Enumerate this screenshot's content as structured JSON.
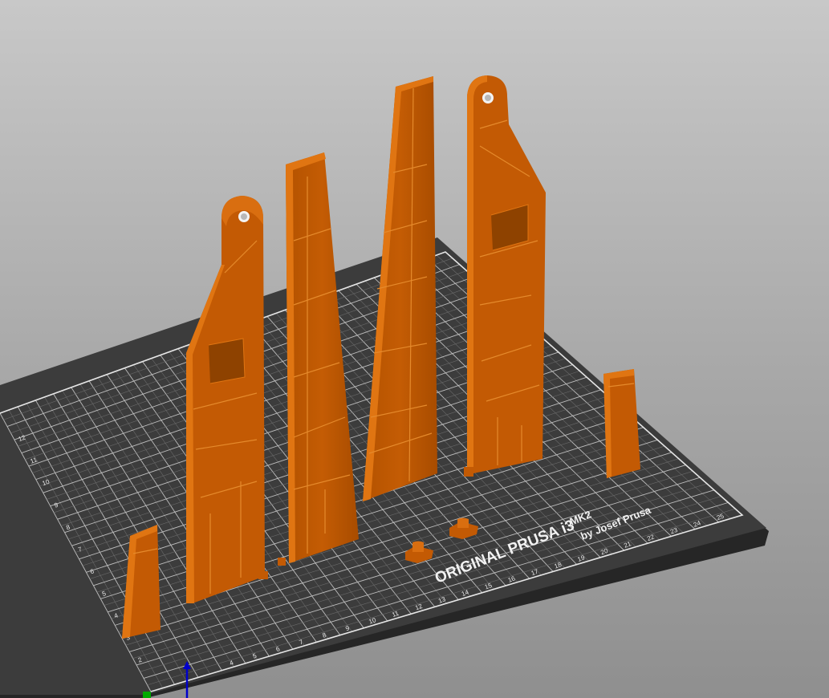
{
  "viewport": {
    "name": "3D print preview",
    "colors": {
      "background_top": "#c8c8c8",
      "background_bottom": "#8f8f8f",
      "bed": "#3a3a3a",
      "bed_edge": "#262626",
      "grid": "#d9d9d9",
      "part": "#c85a00",
      "part_light": "#e07512",
      "part_dark": "#8a3c00",
      "axis_z": "#0000cc",
      "axis_x": "#00aa00"
    }
  },
  "bed": {
    "brand_line1": "ORIGINAL PRUSA i3",
    "brand_model": "MK2",
    "brand_line2": "by Josef Prusa",
    "x_ticks": [
      "4",
      "5",
      "6",
      "7",
      "8",
      "9",
      "10",
      "11",
      "12",
      "13",
      "14",
      "15",
      "16",
      "17",
      "18",
      "19",
      "20",
      "21",
      "22",
      "23",
      "24",
      "25"
    ],
    "y_ticks": [
      "2",
      "3",
      "4",
      "5",
      "6",
      "7",
      "8",
      "9",
      "10",
      "11",
      "12"
    ]
  },
  "parts": [
    {
      "name": "blade-with-hole-left"
    },
    {
      "name": "tapered-blade-left"
    },
    {
      "name": "tapered-blade-right"
    },
    {
      "name": "blade-with-hole-right"
    },
    {
      "name": "small-block-left"
    },
    {
      "name": "small-block-right"
    },
    {
      "name": "peg-left"
    },
    {
      "name": "peg-right"
    }
  ]
}
